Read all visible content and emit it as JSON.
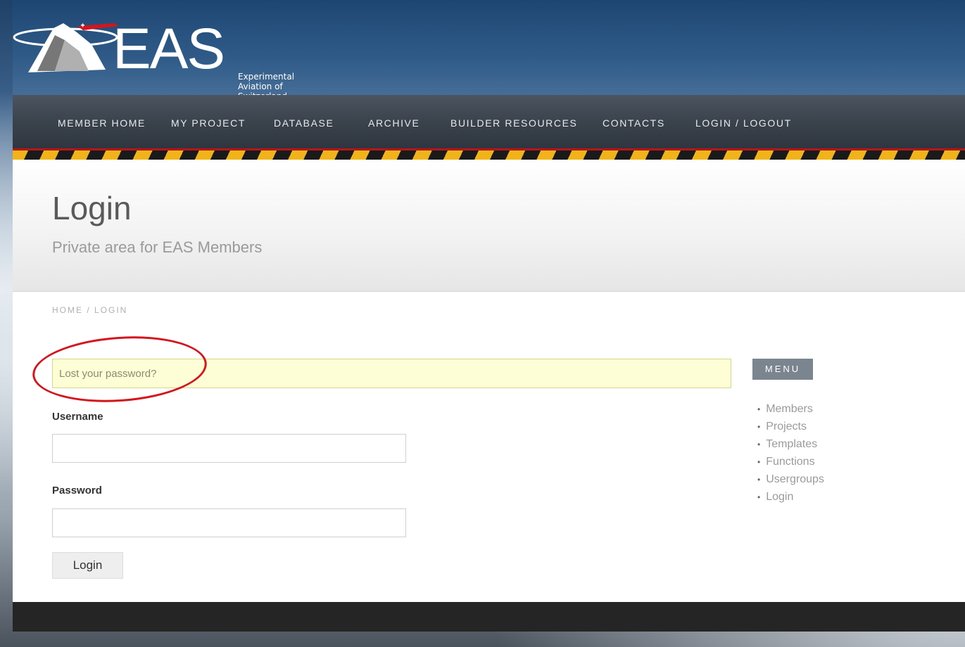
{
  "brand": {
    "logo_text": "EAS",
    "tagline": "Experimental Aviation of Switzerland"
  },
  "nav": {
    "items": [
      "MEMBER HOME",
      "MY PROJECT",
      "DATABASE",
      "ARCHIVE",
      "BUILDER RESOURCES",
      "CONTACTS",
      "LOGIN / LOGOUT"
    ]
  },
  "page": {
    "title": "Login",
    "subtitle": "Private area for EAS Members",
    "breadcrumb": "HOME / LOGIN"
  },
  "form": {
    "lost_password": "Lost your password?",
    "username_label": "Username",
    "username_value": "",
    "password_label": "Password",
    "password_value": "",
    "login_button": "Login"
  },
  "sidebar": {
    "title": "MENU",
    "items": [
      "Members",
      "Projects",
      "Templates",
      "Functions",
      "Usergroups",
      "Login"
    ]
  },
  "colors": {
    "header_blue": "#1e4673",
    "nav_dark": "#3a424c",
    "stripe_yellow": "#f0b41a",
    "stripe_red": "#b8141a",
    "annotation_circle": "#d4151b",
    "notice_bg": "#fdfdd6"
  },
  "icons": {
    "logo": "matterhorn-plane-logo-icon",
    "annotation": "red-circle-highlight"
  }
}
